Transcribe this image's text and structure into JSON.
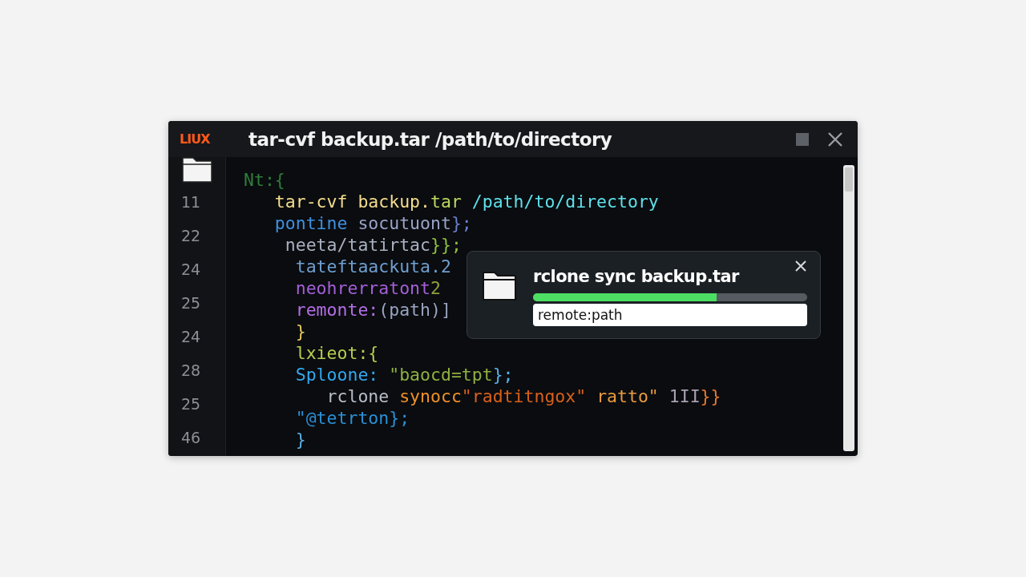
{
  "window": {
    "logo": "LIUX",
    "title": "tar-cvf backup.tar /path/to/directory"
  },
  "line_numbers": [
    "11",
    "22",
    "24",
    "25",
    "24",
    "28",
    "25",
    "46"
  ],
  "code_lines": [
    {
      "tokens": [
        {
          "text": "Nt:{",
          "color": "#2f7d3a"
        }
      ]
    },
    {
      "tokens": [
        {
          "text": "   tar-cvf backup.",
          "color": "#f3dc8c"
        },
        {
          "text": "tar",
          "color": "#b9d860"
        },
        {
          "text": " /path/to/directory",
          "color": "#5fe0ea"
        }
      ]
    },
    {
      "tokens": [
        {
          "text": "   pontine",
          "color": "#3f8fe0"
        },
        {
          "text": " socutuont",
          "color": "#9aa3c8"
        },
        {
          "text": "};",
          "color": "#6a7fd0"
        }
      ]
    },
    {
      "tokens": [
        {
          "text": "    neeta/tatirtac",
          "color": "#a9b0c0"
        },
        {
          "text": "}};",
          "color": "#8fbf40"
        }
      ]
    },
    {
      "tokens": [
        {
          "text": "     tateftaackuta.2",
          "color": "#6f9fd0"
        }
      ]
    },
    {
      "tokens": [
        {
          "text": "     neohrerratont",
          "color": "#a45fd8"
        },
        {
          "text": "2",
          "color": "#8fa040"
        }
      ]
    },
    {
      "tokens": [
        {
          "text": "     remonte:",
          "color": "#b46ee6"
        },
        {
          "text": "(path)]",
          "color": "#9aa3c0"
        }
      ]
    },
    {
      "tokens": [
        {
          "text": "     }",
          "color": "#e8c860"
        }
      ]
    },
    {
      "tokens": [
        {
          "text": "     lxieot:{",
          "color": "#b9cc50"
        }
      ]
    },
    {
      "tokens": [
        {
          "text": "     Sploone: ",
          "color": "#32a8f0"
        },
        {
          "text": "\"baocd=tpt",
          "color": "#8fb040"
        },
        {
          "text": "};",
          "color": "#5ab0e8"
        }
      ]
    },
    {
      "tokens": [
        {
          "text": "        rclone ",
          "color": "#b8bcc8"
        },
        {
          "text": "synocc",
          "color": "#f09028"
        },
        {
          "text": "\"radtitngox\"",
          "color": "#d8601c"
        },
        {
          "text": " ratto\" ",
          "color": "#e89a40"
        },
        {
          "text": "1II",
          "color": "#a8a0b0"
        },
        {
          "text": "}}",
          "color": "#e87a30"
        }
      ]
    },
    {
      "tokens": [
        {
          "text": "     \"@tetrton};",
          "color": "#2a90d8"
        }
      ]
    },
    {
      "tokens": [
        {
          "text": "     }",
          "color": "#5ab0e8"
        }
      ]
    }
  ],
  "dialog": {
    "title": "rclone sync backup.tar",
    "level": 0.67,
    "field_value": "remote:path"
  }
}
